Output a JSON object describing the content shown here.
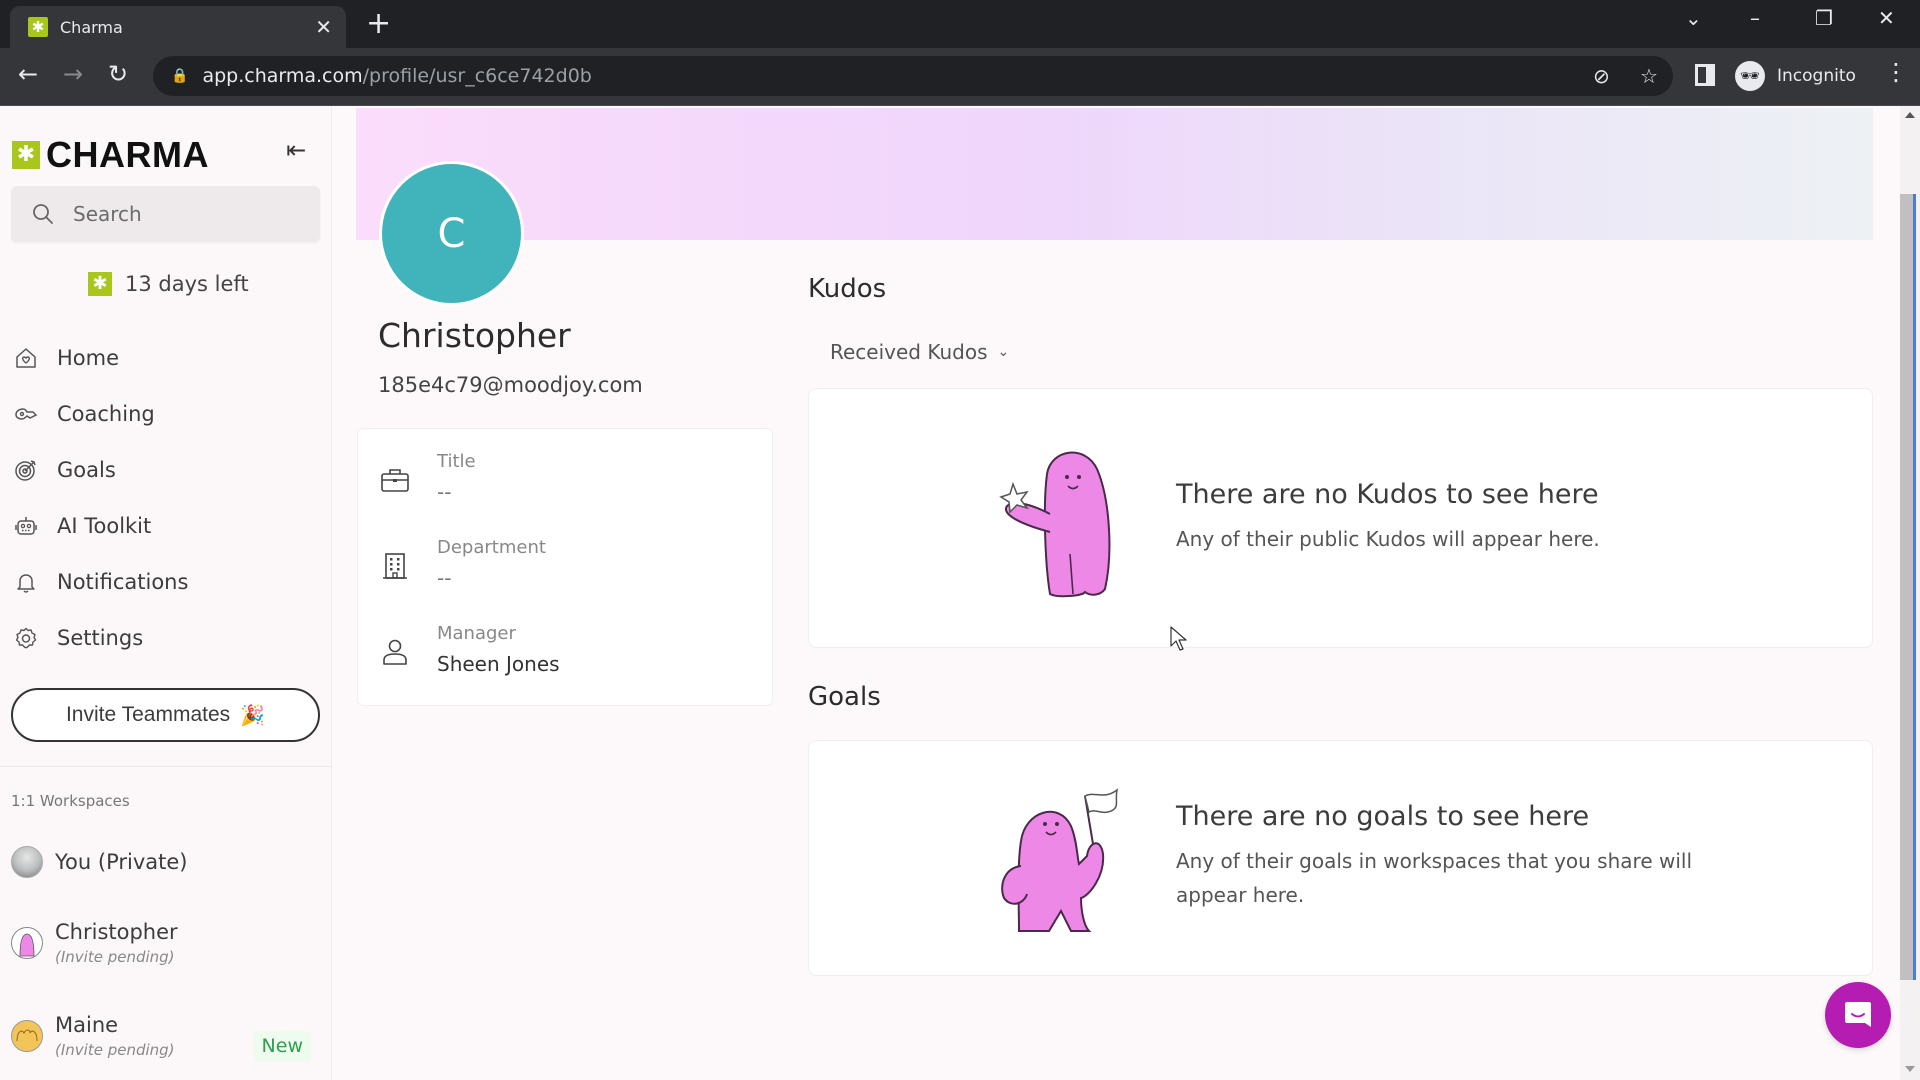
{
  "browser": {
    "tab_title": "Charma",
    "url_host": "app.charma.com",
    "url_path": "/profile/usr_c6ce742d0b",
    "profile_label": "Incognito"
  },
  "sidebar": {
    "brand": "CHARMA",
    "search_placeholder": "Search",
    "trial_text": "13 days left",
    "nav": [
      {
        "label": "Home",
        "icon": "home-icon"
      },
      {
        "label": "Coaching",
        "icon": "whistle-icon"
      },
      {
        "label": "Goals",
        "icon": "target-icon"
      },
      {
        "label": "AI Toolkit",
        "icon": "robot-icon"
      },
      {
        "label": "Notifications",
        "icon": "bell-icon"
      },
      {
        "label": "Settings",
        "icon": "gear-icon"
      }
    ],
    "invite_button": "Invite Teammates",
    "invite_emoji": "🎉",
    "workspaces_label": "1:1 Workspaces",
    "workspaces": [
      {
        "name": "You (Private)",
        "sub": ""
      },
      {
        "name": "Christopher",
        "sub": "(Invite pending)"
      },
      {
        "name": "Maine",
        "sub": "(Invite pending)",
        "badge": "New"
      }
    ]
  },
  "profile": {
    "initial": "C",
    "avatar_color": "#41b3ba",
    "name": "Christopher",
    "email": "185e4c79@moodjoy.com",
    "fields": [
      {
        "label": "Title",
        "value": "--",
        "icon": "briefcase-icon"
      },
      {
        "label": "Department",
        "value": "--",
        "icon": "building-icon"
      },
      {
        "label": "Manager",
        "value": "Sheen Jones",
        "icon": "person-icon"
      }
    ]
  },
  "kudos": {
    "heading": "Kudos",
    "filter": "Received Kudos",
    "empty_title": "There are no Kudos to see here",
    "empty_desc": "Any of their public Kudos will appear here."
  },
  "goals": {
    "heading": "Goals",
    "empty_title": "There are no goals to see here",
    "empty_desc": "Any of their goals in workspaces that you share will appear here."
  },
  "colors": {
    "brand_green": "#a8c61c",
    "chat_purple": "#b41cb2",
    "illustration_pink": "#ee88e6"
  }
}
